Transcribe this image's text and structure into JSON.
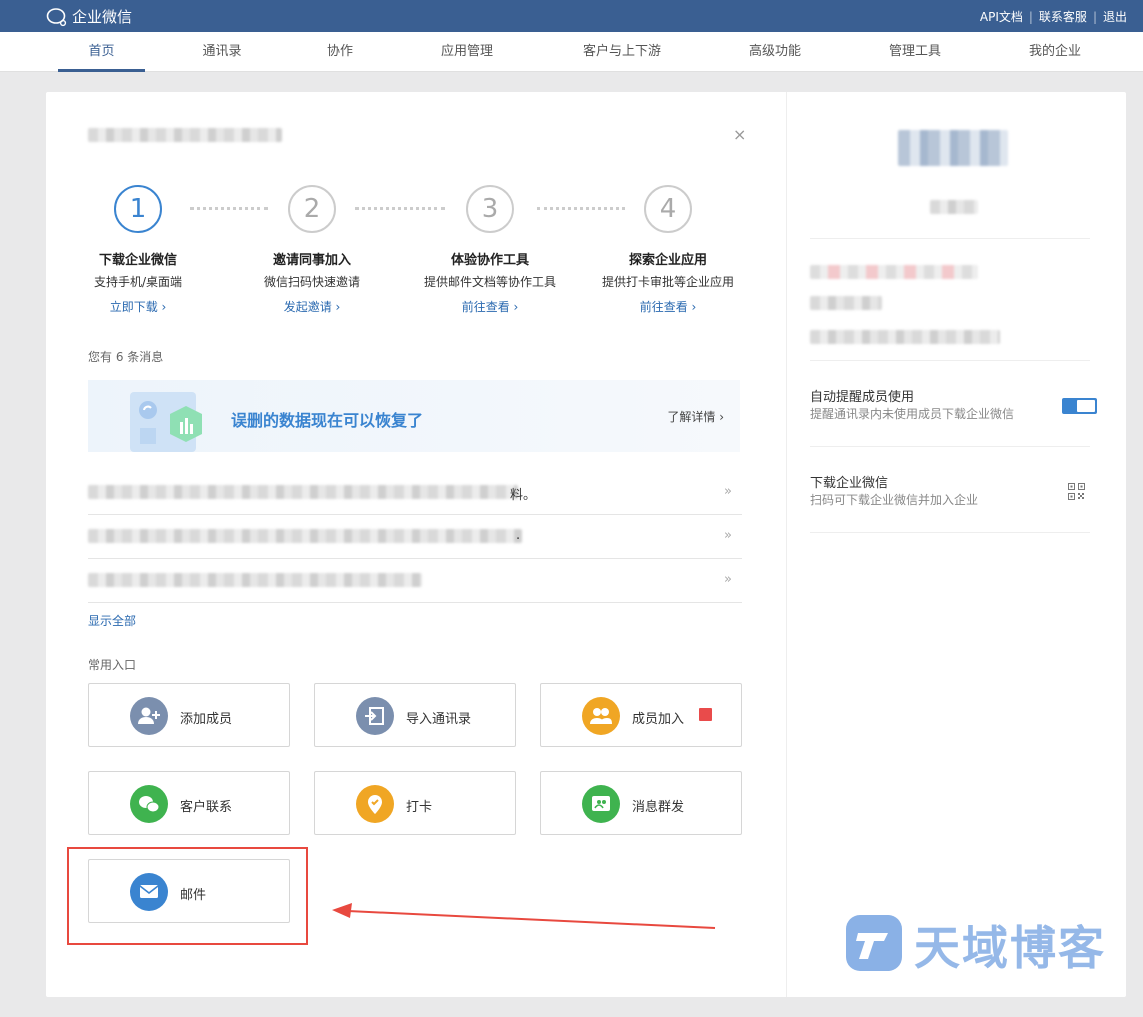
{
  "app": {
    "title": "企业微信"
  },
  "toplinks": {
    "api": "API文档",
    "support": "联系客服",
    "logout": "退出"
  },
  "nav": [
    "首页",
    "通讯录",
    "协作",
    "应用管理",
    "客户与上下游",
    "高级功能",
    "管理工具",
    "我的企业"
  ],
  "steps": [
    {
      "num": "1",
      "title": "下载企业微信",
      "desc": "支持手机/桌面端",
      "link": "立即下载 ›"
    },
    {
      "num": "2",
      "title": "邀请同事加入",
      "desc": "微信扫码快速邀请",
      "link": "发起邀请 ›"
    },
    {
      "num": "3",
      "title": "体验协作工具",
      "desc": "提供邮件文档等协作工具",
      "link": "前往查看 ›"
    },
    {
      "num": "4",
      "title": "探索企业应用",
      "desc": "提供打卡审批等企业应用",
      "link": "前往查看 ›"
    }
  ],
  "messages": {
    "count_label": "您有 6 条消息",
    "banner_text": "误删的数据现在可以恢复了",
    "banner_link": "了解详情 ›",
    "row1_tail": "料。",
    "row2_tail": ".",
    "row3_tail": "",
    "show_all": "显示全部"
  },
  "shortcuts": {
    "section_label": "常用入口",
    "items": [
      {
        "label": "添加成员",
        "color": "#7b8fae",
        "icon": "add-user-icon"
      },
      {
        "label": "导入通讯录",
        "color": "#7b8fae",
        "icon": "import-icon"
      },
      {
        "label": "成员加入",
        "color": "#f0a624",
        "icon": "members-icon"
      },
      {
        "label": "客户联系",
        "color": "#3fb34f",
        "icon": "wechat-icon"
      },
      {
        "label": "打卡",
        "color": "#f0a624",
        "icon": "location-pin-icon"
      },
      {
        "label": "消息群发",
        "color": "#3fb34f",
        "icon": "broadcast-icon"
      },
      {
        "label": "邮件",
        "color": "#3a84d0",
        "icon": "mail-icon"
      }
    ]
  },
  "right": {
    "remind_title": "自动提醒成员使用",
    "remind_desc": "提醒通讯录内未使用成员下载企业微信",
    "remind_enabled": true,
    "download_title": "下载企业微信",
    "download_desc": "扫码可下载企业微信并加入企业"
  },
  "watermark": "天域博客",
  "colors": {
    "brand": "#3a5f92",
    "accent": "#3a84d0",
    "highlight": "#e8493f"
  }
}
